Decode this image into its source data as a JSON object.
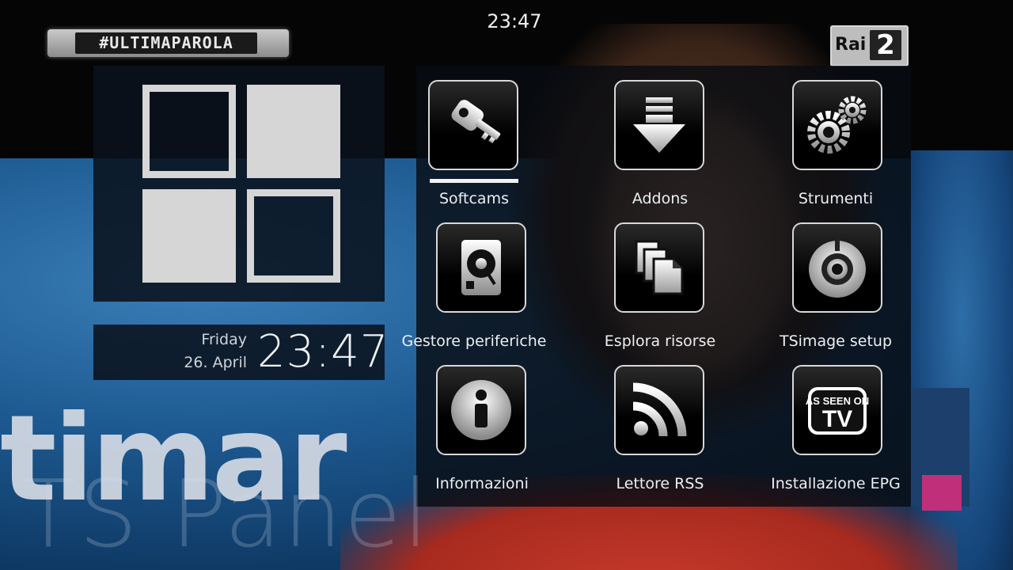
{
  "header": {
    "time": "23:47",
    "hashtag_bug": "#ULTIMAPAROLA",
    "channel_logo": {
      "brand": "Rai",
      "number": "2"
    }
  },
  "clock": {
    "day": "Friday",
    "date": "26. April",
    "time": "23:47"
  },
  "menu": {
    "selected_index": 0,
    "items": [
      {
        "label": "Softcams",
        "icon": "key-icon"
      },
      {
        "label": "Addons",
        "icon": "download-arrow-icon"
      },
      {
        "label": "Strumenti",
        "icon": "gears-icon"
      },
      {
        "label": "Gestore periferiche",
        "icon": "hard-drive-icon"
      },
      {
        "label": "Esplora risorse",
        "icon": "files-icon"
      },
      {
        "label": "TSimage setup",
        "icon": "knob-icon"
      },
      {
        "label": "Informazioni",
        "icon": "info-icon"
      },
      {
        "label": "Lettore RSS",
        "icon": "rss-icon"
      },
      {
        "label": "Installazione EPG",
        "icon": "as-seen-on-tv-icon"
      }
    ],
    "tv_icon_text": {
      "top": "AS SEEN ON",
      "bottom": "TV"
    }
  },
  "watermark": "TS Panel",
  "colors": {
    "panel_bg": "#0a121e",
    "icon_border": "#d8d8d8",
    "selector": "#f2f2f2",
    "text": "#eceff2"
  }
}
